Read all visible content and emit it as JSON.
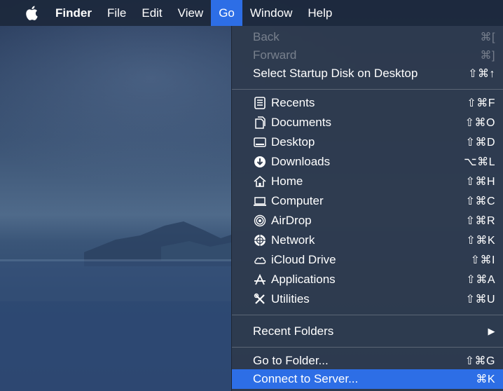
{
  "menubar": {
    "items": [
      "Finder",
      "File",
      "Edit",
      "View",
      "Go",
      "Window",
      "Help"
    ]
  },
  "go_menu": {
    "nav": [
      {
        "label": "Back",
        "shortcut": "⌘["
      },
      {
        "label": "Forward",
        "shortcut": "⌘]"
      },
      {
        "label": "Select Startup Disk on Desktop",
        "shortcut": "⇧⌘↑"
      }
    ],
    "places": [
      {
        "label": "Recents",
        "shortcut": "⇧⌘F",
        "icon": "recents-icon"
      },
      {
        "label": "Documents",
        "shortcut": "⇧⌘O",
        "icon": "documents-icon"
      },
      {
        "label": "Desktop",
        "shortcut": "⇧⌘D",
        "icon": "desktop-icon"
      },
      {
        "label": "Downloads",
        "shortcut": "⌥⌘L",
        "icon": "downloads-icon"
      },
      {
        "label": "Home",
        "shortcut": "⇧⌘H",
        "icon": "home-icon"
      },
      {
        "label": "Computer",
        "shortcut": "⇧⌘C",
        "icon": "computer-icon"
      },
      {
        "label": "AirDrop",
        "shortcut": "⇧⌘R",
        "icon": "airdrop-icon"
      },
      {
        "label": "Network",
        "shortcut": "⇧⌘K",
        "icon": "network-icon"
      },
      {
        "label": "iCloud Drive",
        "shortcut": "⇧⌘I",
        "icon": "icloud-icon"
      },
      {
        "label": "Applications",
        "shortcut": "⇧⌘A",
        "icon": "applications-icon"
      },
      {
        "label": "Utilities",
        "shortcut": "⇧⌘U",
        "icon": "utilities-icon"
      }
    ],
    "recent_folders": {
      "label": "Recent Folders",
      "arrow": "▶"
    },
    "goto": [
      {
        "label": "Go to Folder...",
        "shortcut": "⇧⌘G"
      },
      {
        "label": "Connect to Server...",
        "shortcut": "⌘K"
      }
    ]
  },
  "colors": {
    "highlight": "#2d6ee6",
    "menu_bg": "#2e3a4e"
  }
}
